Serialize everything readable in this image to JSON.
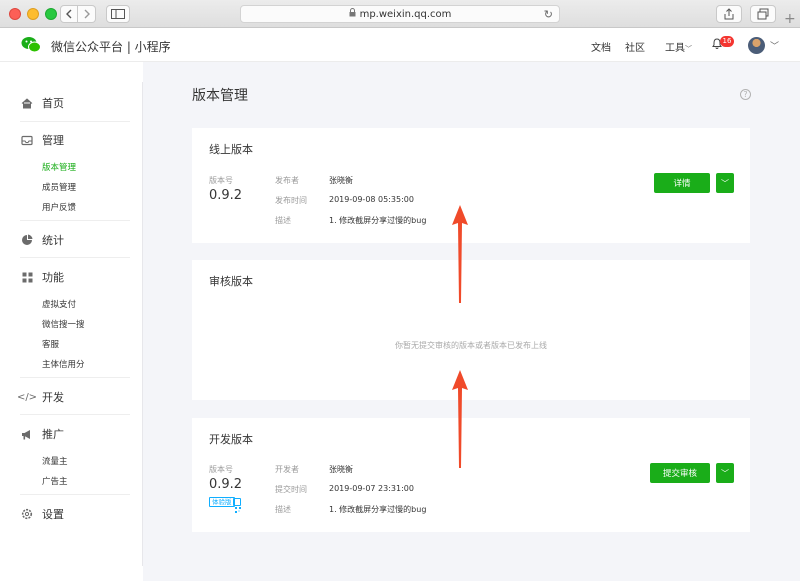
{
  "browser": {
    "url": "mp.weixin.qq.com"
  },
  "header": {
    "site_title": "微信公众平台 | 小程序",
    "links": {
      "docs": "文档",
      "community": "社区",
      "tools": "工具"
    },
    "notification_count": "16"
  },
  "sidebar": {
    "home": "首页",
    "manage": {
      "label": "管理",
      "items": [
        "版本管理",
        "成员管理",
        "用户反馈"
      ]
    },
    "stats": "统计",
    "features": {
      "label": "功能",
      "items": [
        "虚拟支付",
        "微信搜一搜",
        "客服",
        "主体信用分"
      ]
    },
    "develop": "开发",
    "promote": {
      "label": "推广",
      "items": [
        "流量主",
        "广告主"
      ]
    },
    "settings": "设置"
  },
  "page": {
    "title": "版本管理"
  },
  "online_version": {
    "title": "线上版本",
    "version_label": "版本号",
    "version": "0.9.2",
    "publisher_label": "发布者",
    "publisher": "张晓衡",
    "time_label": "发布时间",
    "time": "2019-09-08 05:35:00",
    "desc_label": "描述",
    "desc": "1. 修改截屏分享过慢的bug",
    "detail_button": "详情"
  },
  "review_version": {
    "title": "审核版本",
    "empty_text": "你暂无提交审核的版本或者版本已发布上线"
  },
  "dev_version": {
    "title": "开发版本",
    "version_label": "版本号",
    "version": "0.9.2",
    "trial_tag": "体验版",
    "developer_label": "开发者",
    "developer": "张晓衡",
    "time_label": "提交时间",
    "time": "2019-09-07 23:31:00",
    "desc_label": "描述",
    "desc": "1. 修改截屏分享过慢的bug",
    "submit_button": "提交审核"
  },
  "colors": {
    "brand_green": "#1aad19",
    "annotation_red": "#f04a2a",
    "badge_red": "#f43530",
    "trial_blue": "#10aeff"
  }
}
